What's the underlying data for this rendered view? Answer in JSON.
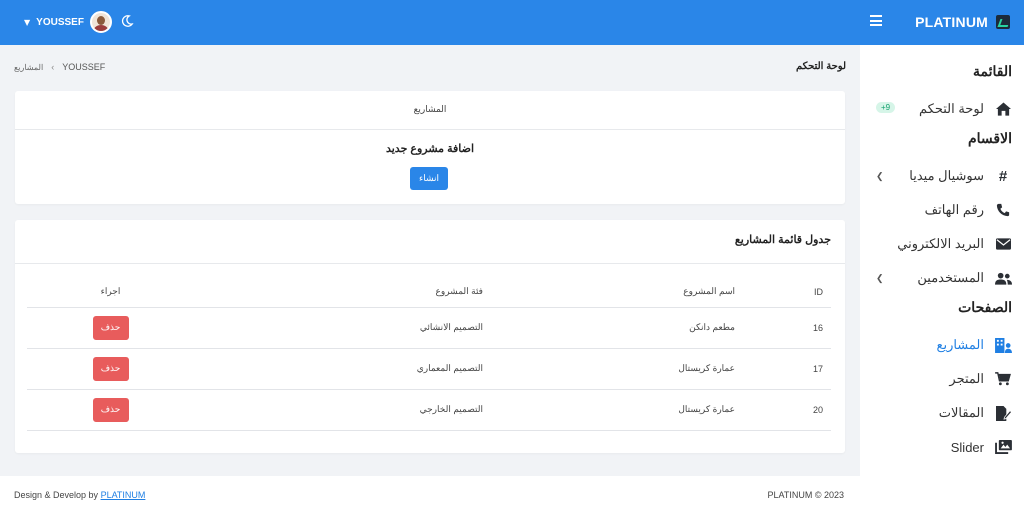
{
  "topbar": {
    "brand": "PLATINUM",
    "user_name": "YOUSSEF",
    "accent": "#2a86e8"
  },
  "sidebar": {
    "menu_heading": "القائمة",
    "dashboard": "لوحة التحكم",
    "dashboard_badge": "+9",
    "sections_heading": "الاقسام",
    "social": "سوشيال ميديا",
    "phone": "رقم الهاتف",
    "email": "البريد الالكتروني",
    "users": "المستخدمين",
    "pages_heading": "الصفحات",
    "projects": "المشاريع",
    "store": "المتجر",
    "articles": "المقالات",
    "slider": "Slider"
  },
  "page": {
    "title": "لوحة التحكم",
    "breadcrumb_current": "YOUSSEF",
    "breadcrumb_sep": "‹",
    "breadcrumb_link": "المشاريع"
  },
  "new_project_card": {
    "header": "المشاريع",
    "title": "اضافة مشروع جديد",
    "create_label": "انشاء"
  },
  "table_card": {
    "title": "جدول قائمة المشاريع",
    "columns": {
      "id": "ID",
      "name": "اسم المشروع",
      "category": "فئة المشروع",
      "action": "اجراء"
    },
    "rows": [
      {
        "id": "16",
        "name": "مطعم دانكن",
        "category": "التصميم الانشائي",
        "action": "حذف"
      },
      {
        "id": "17",
        "name": "عمارة كريستال",
        "category": "التصميم المعماري",
        "action": "حذف"
      },
      {
        "id": "20",
        "name": "عمارة كريستال",
        "category": "التصميم الخارجي",
        "action": "حذف"
      }
    ],
    "delete_color": "#e85c5c"
  },
  "footer": {
    "left_text": "Design & Develop by",
    "left_link": "PLATINUM",
    "right_text": "PLATINUM © 2023"
  },
  "icons": [
    "hamburger-icon",
    "moon-icon",
    "chevron-down-icon",
    "home-icon",
    "hash-icon",
    "phone-icon",
    "envelope-icon",
    "users-icon",
    "projects-icon",
    "cart-icon",
    "article-icon",
    "slider-icon",
    "chevron-left-icon"
  ]
}
